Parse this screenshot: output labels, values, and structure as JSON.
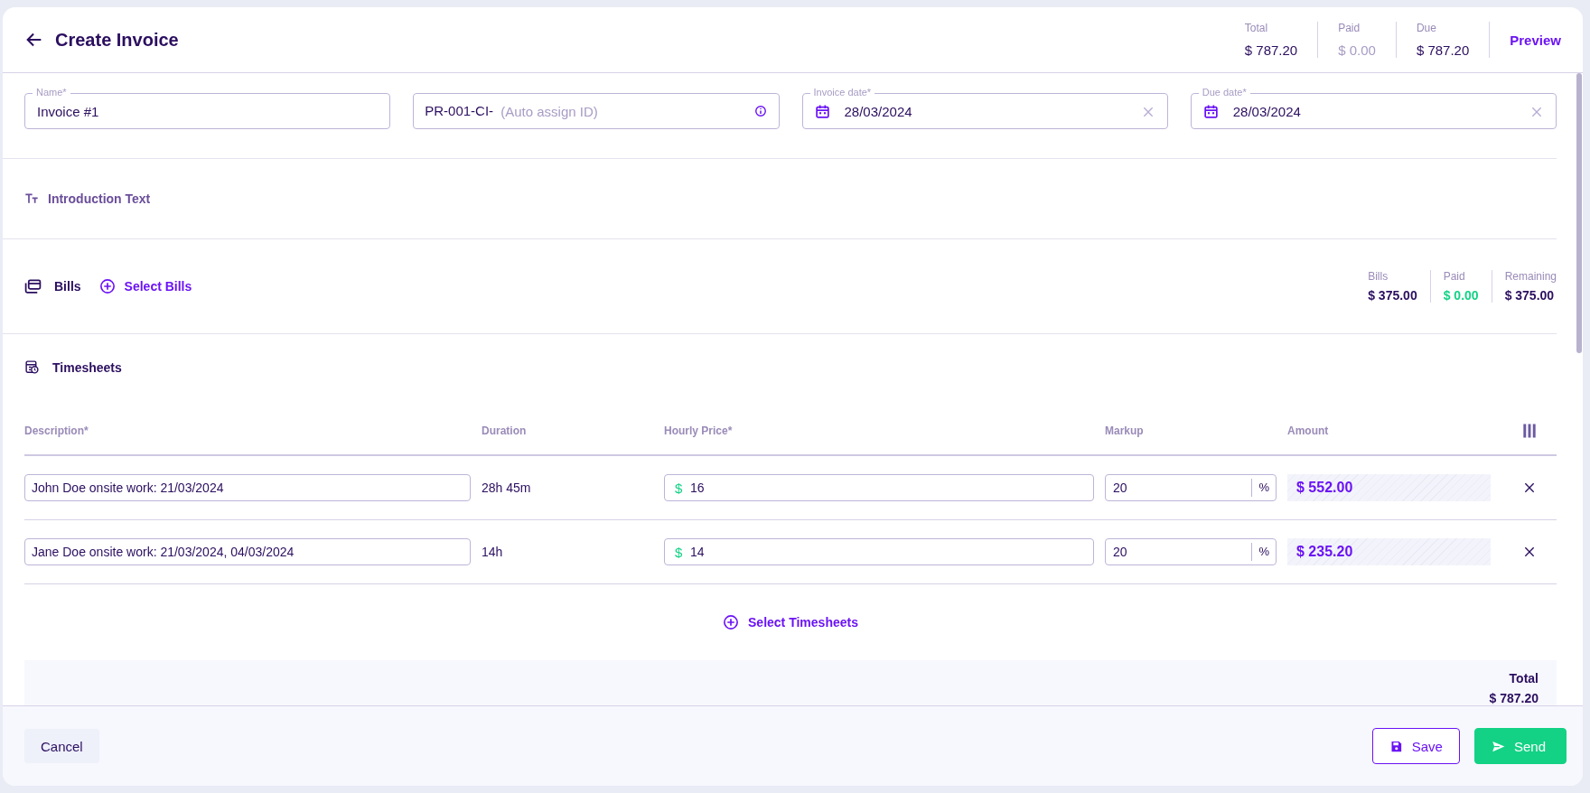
{
  "header": {
    "title": "Create Invoice",
    "summary": [
      {
        "label": "Total",
        "value": "$ 787.20",
        "muted": false
      },
      {
        "label": "Paid",
        "value": "$ 0.00",
        "muted": true
      },
      {
        "label": "Due",
        "value": "$ 787.20",
        "muted": false
      }
    ],
    "preview": "Preview"
  },
  "fields": [
    {
      "kind": "text",
      "label": "Name*",
      "value": "Invoice #1"
    },
    {
      "kind": "id",
      "value": "PR-001-CI-",
      "placeholder": "(Auto assign ID)"
    },
    {
      "kind": "date",
      "label": "Invoice date*",
      "value": "28/03/2024"
    },
    {
      "kind": "date",
      "label": "Due date*",
      "value": "28/03/2024"
    }
  ],
  "intro": {
    "label": "Introduction Text"
  },
  "bills": {
    "title": "Bills",
    "action": "Select Bills",
    "summary": [
      {
        "label": "Bills",
        "value": "$ 375.00",
        "positive": false
      },
      {
        "label": "Paid",
        "value": "$ 0.00",
        "positive": true
      },
      {
        "label": "Remaining",
        "value": "$ 375.00",
        "positive": false
      }
    ]
  },
  "timesheets": {
    "title": "Timesheets",
    "columns": [
      "Description*",
      "Duration",
      "Hourly Price*",
      "Markup",
      "Amount"
    ],
    "rows": [
      {
        "description": "John Doe onsite work: 21/03/2024",
        "duration": "28h 45m",
        "currency": "$",
        "hourly_price": "16",
        "markup": "20",
        "markup_unit": "%",
        "amount": "$ 552.00"
      },
      {
        "description": "Jane Doe onsite work: 21/03/2024, 04/03/2024",
        "duration": "14h",
        "currency": "$",
        "hourly_price": "14",
        "markup": "20",
        "markup_unit": "%",
        "amount": "$ 235.20"
      }
    ],
    "action": "Select Timesheets",
    "total": {
      "label": "Total",
      "value": "$ 787.20"
    }
  },
  "footer": {
    "cancel": "Cancel",
    "save": "Save",
    "send": "Send"
  }
}
